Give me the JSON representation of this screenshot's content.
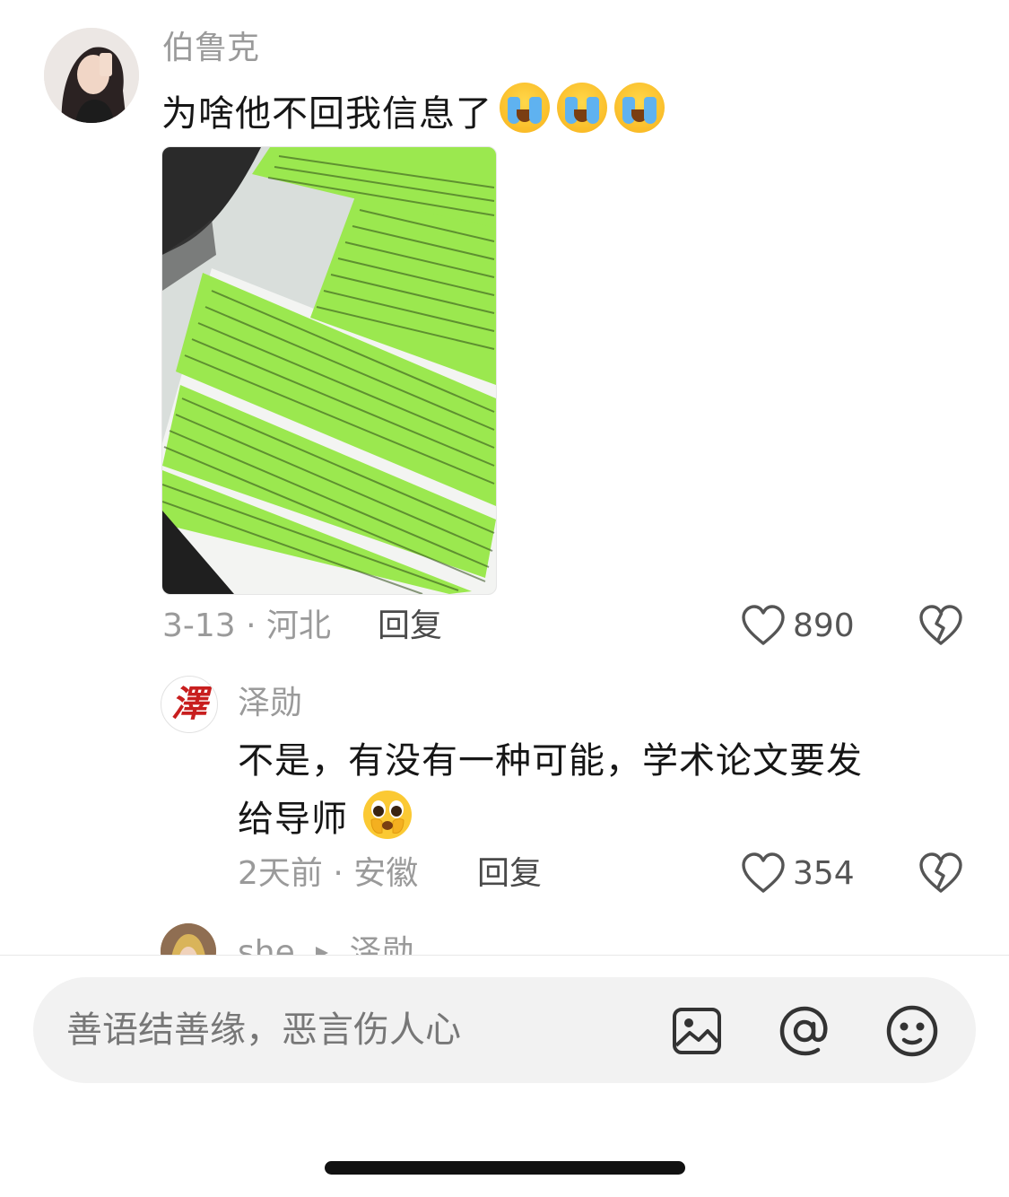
{
  "comments": [
    {
      "username": "伯鲁克",
      "text": "为啥他不回我信息了",
      "emoji": "loudly-crying-face",
      "image": "screenshot-of-long-green-chat-messages",
      "meta": "3-13 · 河北",
      "reply_label": "回复",
      "likes": "890"
    },
    {
      "username": "泽勋",
      "avatar_char": "澤",
      "text_line1": "不是，有没有一种可能，学术论文要发",
      "text_line2": "给导师",
      "emoji": "pleading-face",
      "meta": "2天前 · 安徽",
      "reply_label": "回复",
      "likes": "354"
    },
    {
      "username": "she",
      "reply_to": "泽勋"
    }
  ],
  "input": {
    "placeholder": "善语结善缘，恶言伤人心",
    "icons": [
      "image-icon",
      "at-icon",
      "emoji-icon"
    ]
  },
  "colors": {
    "green_bubble": "#9be84f",
    "secondary_text": "#9a9a9a",
    "input_bg": "#f2f2f2"
  }
}
